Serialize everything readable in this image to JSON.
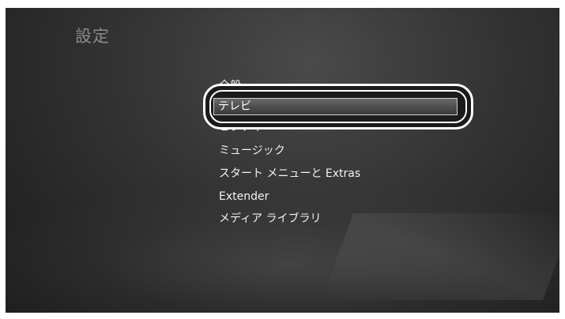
{
  "page": {
    "title": "設定"
  },
  "menu": {
    "items": [
      {
        "label": "全般",
        "state": "partially-hidden"
      },
      {
        "label": "テレビ",
        "state": "selected"
      },
      {
        "label": "ピクチャ",
        "state": "partially-hidden"
      },
      {
        "label": "ミュージック",
        "state": "normal"
      },
      {
        "label": "スタート メニューと Extras",
        "state": "normal"
      },
      {
        "label": "Extender",
        "state": "normal"
      },
      {
        "label": "メディア ライブラリ",
        "state": "normal"
      }
    ]
  },
  "colors": {
    "background": "#2e2e2e",
    "text": "#f2f2f2",
    "title": "#8a8a8a",
    "highlight_border": "#ffffff"
  }
}
